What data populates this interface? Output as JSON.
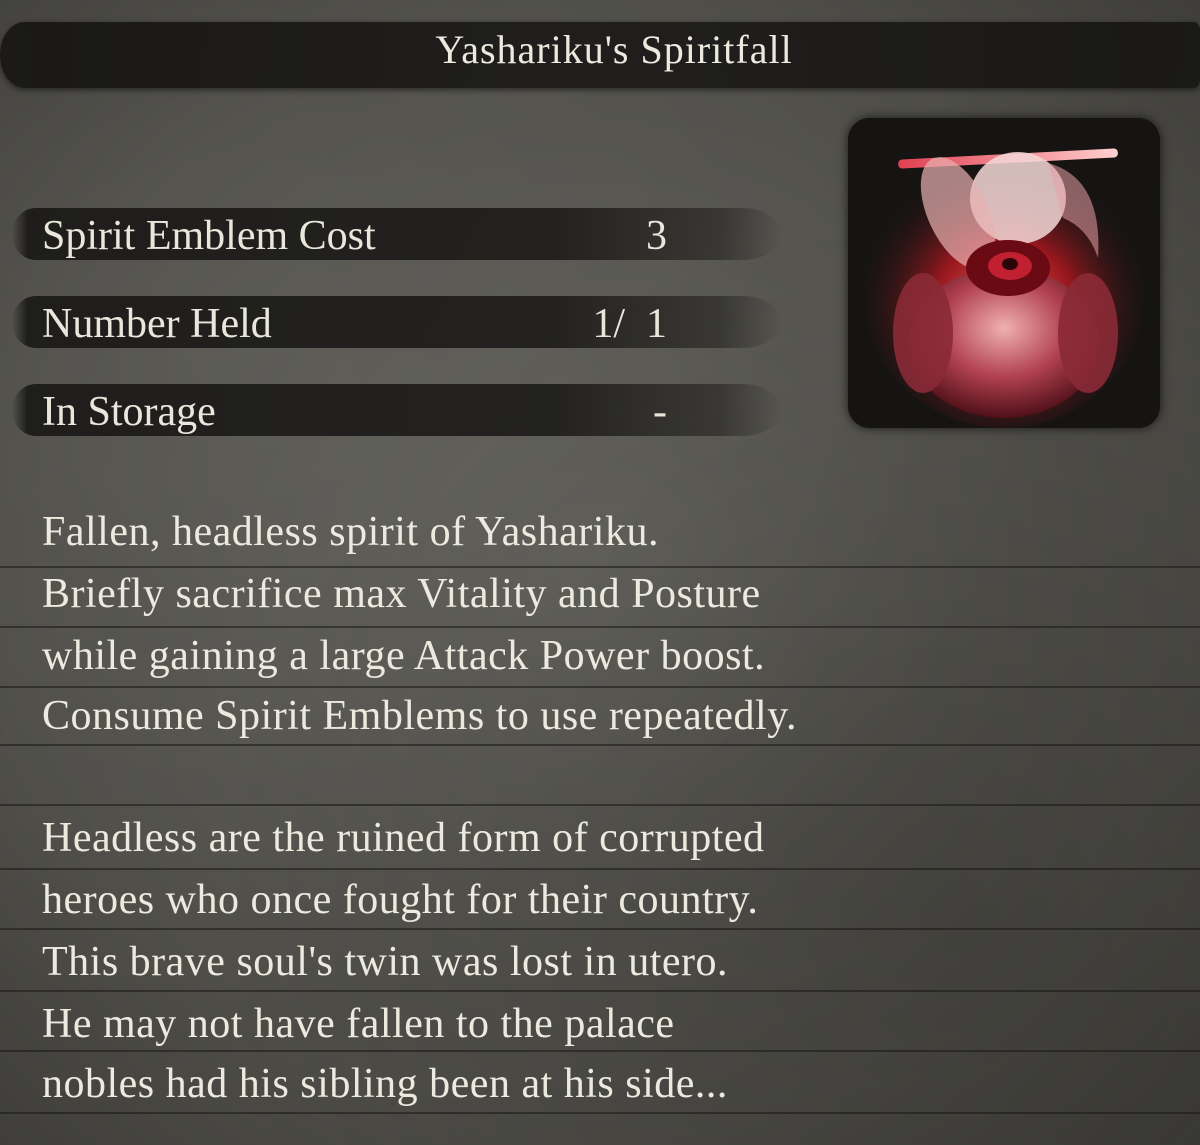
{
  "item": {
    "title": "Yashariku's Spiritfall"
  },
  "stats": [
    {
      "label": "Spirit Emblem Cost",
      "value": "3"
    },
    {
      "label": "Number Held",
      "value": "1/  1"
    },
    {
      "label": "In Storage",
      "value": "-"
    }
  ],
  "icon": {
    "name": "yashariku-spiritfall-icon"
  },
  "description": {
    "effect_lines": [
      "Fallen, headless spirit of Yashariku.",
      "Briefly sacrifice max Vitality and Posture",
      "while gaining a large Attack Power boost.",
      "Consume Spirit Emblems to use repeatedly."
    ],
    "lore_lines": [
      "Headless are the ruined form of corrupted",
      "heroes who once fought for their country.",
      "This brave soul's twin was lost in utero.",
      "He may not have fallen to the palace",
      "nobles had his sibling been at his side..."
    ]
  },
  "colors": {
    "panel_background": "#55544f",
    "bar_color": "#1c1b19",
    "text_color": "#ece9df",
    "icon_accent": "#c8242c"
  }
}
